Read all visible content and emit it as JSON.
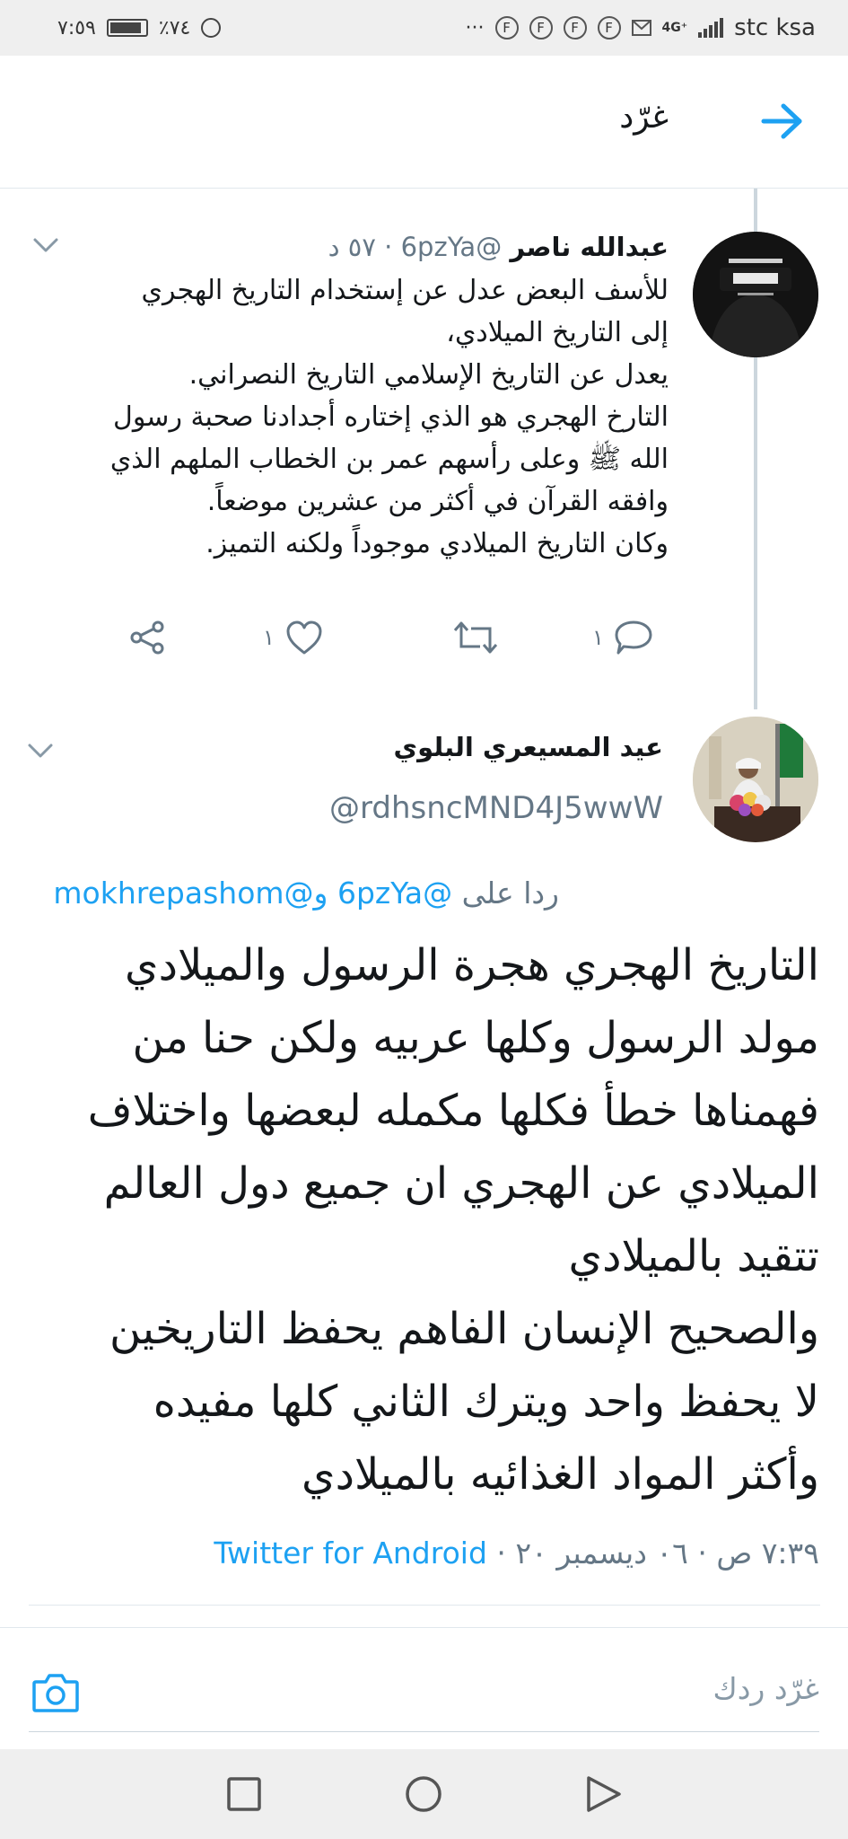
{
  "status_bar": {
    "time": "٧:٥٩",
    "battery": "٪٧٤",
    "more": "···",
    "notif_badge": "F",
    "network": "4G⁺",
    "carrier": "stc ksa"
  },
  "header": {
    "title": "غرّد"
  },
  "tweet1": {
    "author_name": "عبدالله ناصر",
    "handle": "@6pzYa",
    "time": "٥٧ د",
    "separator": "·",
    "text": "للأسف البعض عدل عن إستخدام التاريخ الهجري\nإلى التاريخ الميلادي،\nيعدل عن التاريخ الإسلامي التاريخ النصراني.\nالتارخ الهجري هو الذي إختاره أجدادنا صحبة رسول\nالله ﷺ وعلى رأسهم عمر بن الخطاب الملهم الذي\nوافقه القرآن في أكثر من عشرين موضعاً.\nوكان التاريخ الميلادي موجوداً ولكنه التميز.",
    "reply_count": "١",
    "like_count": "١"
  },
  "tweet2": {
    "author_name": "عيد المسيعري البلوي",
    "handle": "@rdhsncMND4J5wwW",
    "replying_prefix": "ردا على",
    "reply_to_1": "@6pzYa",
    "reply_and": "و",
    "reply_to_2": "@mokhrepashom",
    "text": "التاريخ الهجري هجرة الرسول والميلادي\nمولد الرسول وكلها عربيه ولكن حنا من\nفهمناها خطأ فكلها مكمله لبعضها واختلاف\nالميلادي عن الهجري ان جميع دول العالم\nتتقيد بالميلادي\nوالصحيح الإنسان الفاهم يحفظ التاريخين\nلا يحفظ واحد ويترك الثاني كلها مفيده\nوأكثر المواد الغذائيه بالميلادي",
    "timestamp": "٧:٣٩ ص · ٠٦ ديسمبر ٢٠ · ",
    "source": "Twitter for Android"
  },
  "compose": {
    "placeholder": "غرّد ردك"
  },
  "colors": {
    "accent": "#1da1f2",
    "muted": "#657786",
    "text": "#14171a"
  },
  "icons": [
    "back-arrow-icon",
    "chevron-down-icon",
    "reply-icon",
    "retweet-icon",
    "like-icon",
    "share-icon",
    "camera-icon",
    "square-nav-icon",
    "circle-nav-icon",
    "triangle-back-nav-icon"
  ]
}
